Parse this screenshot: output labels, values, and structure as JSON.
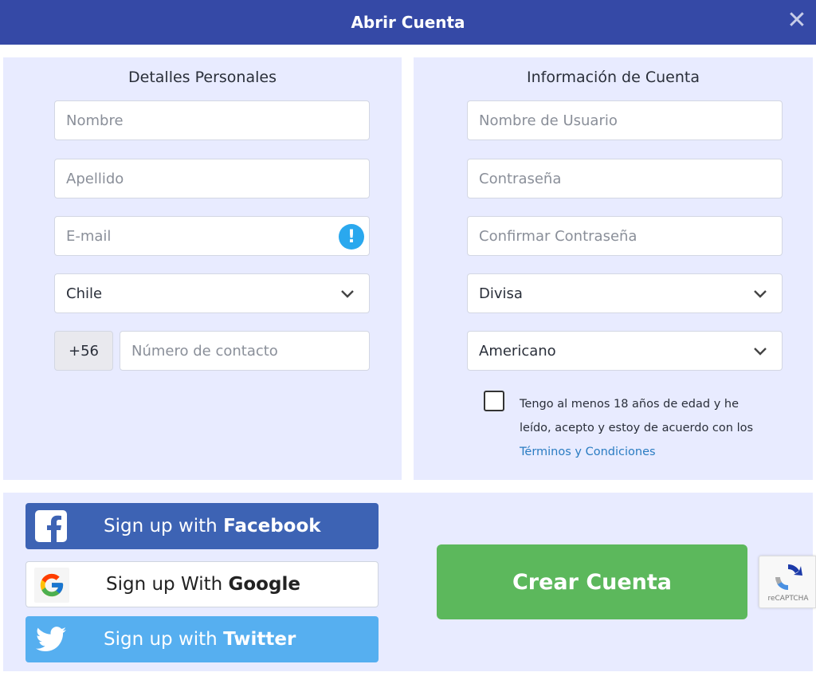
{
  "header": {
    "title": "Abrir Cuenta"
  },
  "personal": {
    "title": "Detalles Personales",
    "first_name_placeholder": "Nombre",
    "last_name_placeholder": "Apellido",
    "email_placeholder": "E-mail",
    "country_value": "Chile",
    "phone_prefix": "+56",
    "phone_placeholder": "Número de contacto"
  },
  "account": {
    "title": "Información de Cuenta",
    "username_placeholder": "Nombre de Usuario",
    "password_placeholder": "Contraseña",
    "confirm_password_placeholder": "Confirmar Contraseña",
    "currency_value": "Divisa",
    "odds_format_value": "Americano",
    "terms_text": "Tengo al menos 18 años de edad y he leído, acepto y estoy de acuerdo con los",
    "terms_link": "Términos y Condiciones"
  },
  "social": {
    "facebook_prefix": "Sign up with",
    "facebook_brand": "Facebook",
    "google_prefix": "Sign up With",
    "google_brand": "Google",
    "twitter_prefix": "Sign up with",
    "twitter_brand": "Twitter"
  },
  "actions": {
    "create_account_label": "Crear Cuenta",
    "recaptcha_label": "reCAPTCHA"
  },
  "colors": {
    "header_bg": "#3549a6",
    "panel_bg": "#e8ebff",
    "facebook": "#3d63b4",
    "twitter": "#56aff0",
    "create_button": "#5cb85c",
    "alert": "#2aa8ee",
    "link": "#2a7cc2"
  },
  "icons": {
    "close": "close-icon",
    "email_alert": "alert-icon",
    "dropdown": "chevron-down-icon",
    "facebook": "facebook-icon",
    "google": "google-icon",
    "twitter": "twitter-icon",
    "recaptcha": "recaptcha-icon"
  }
}
